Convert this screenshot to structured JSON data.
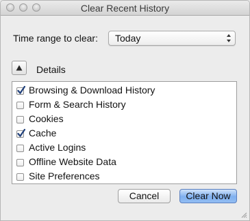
{
  "window": {
    "title": "Clear Recent History"
  },
  "time_range": {
    "label": "Time range to clear:",
    "selected": "Today"
  },
  "details": {
    "label": "Details"
  },
  "items": [
    {
      "label": "Browsing & Download History",
      "checked": true
    },
    {
      "label": "Form & Search History",
      "checked": false
    },
    {
      "label": "Cookies",
      "checked": false
    },
    {
      "label": "Cache",
      "checked": true
    },
    {
      "label": "Active Logins",
      "checked": false
    },
    {
      "label": "Offline Website Data",
      "checked": false
    },
    {
      "label": "Site Preferences",
      "checked": false
    }
  ],
  "buttons": {
    "cancel": "Cancel",
    "clear_now": "Clear Now"
  },
  "colors": {
    "default_button": "#7fb0ef",
    "checkmark": "#1f3f7a"
  }
}
